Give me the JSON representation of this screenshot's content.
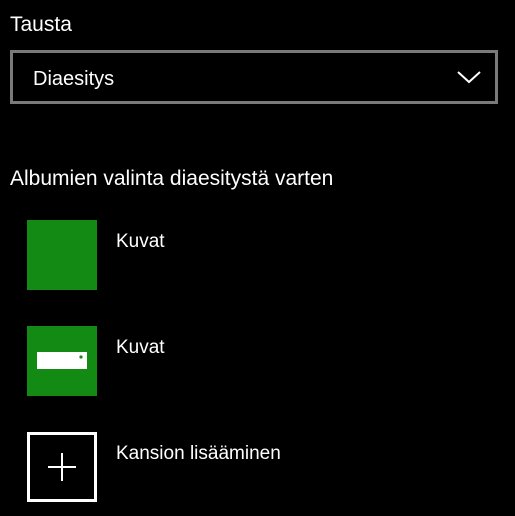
{
  "background": {
    "label": "Tausta",
    "dropdown_value": "Diaesitys",
    "icon": "chevron-down-icon"
  },
  "slideshow": {
    "heading": "Albumien valinta diaesitystä varten",
    "albums": [
      {
        "label": "Kuvat",
        "icon": "folder-thumbnail",
        "color": "#138a13"
      },
      {
        "label": "Kuvat",
        "icon": "drive-icon",
        "color": "#138a13"
      },
      {
        "label": "Kansion lisääminen",
        "icon": "plus-icon"
      }
    ]
  },
  "colors": {
    "accent": "#138a13",
    "border": "#7a7a7a",
    "background": "#000000",
    "text": "#ffffff"
  }
}
